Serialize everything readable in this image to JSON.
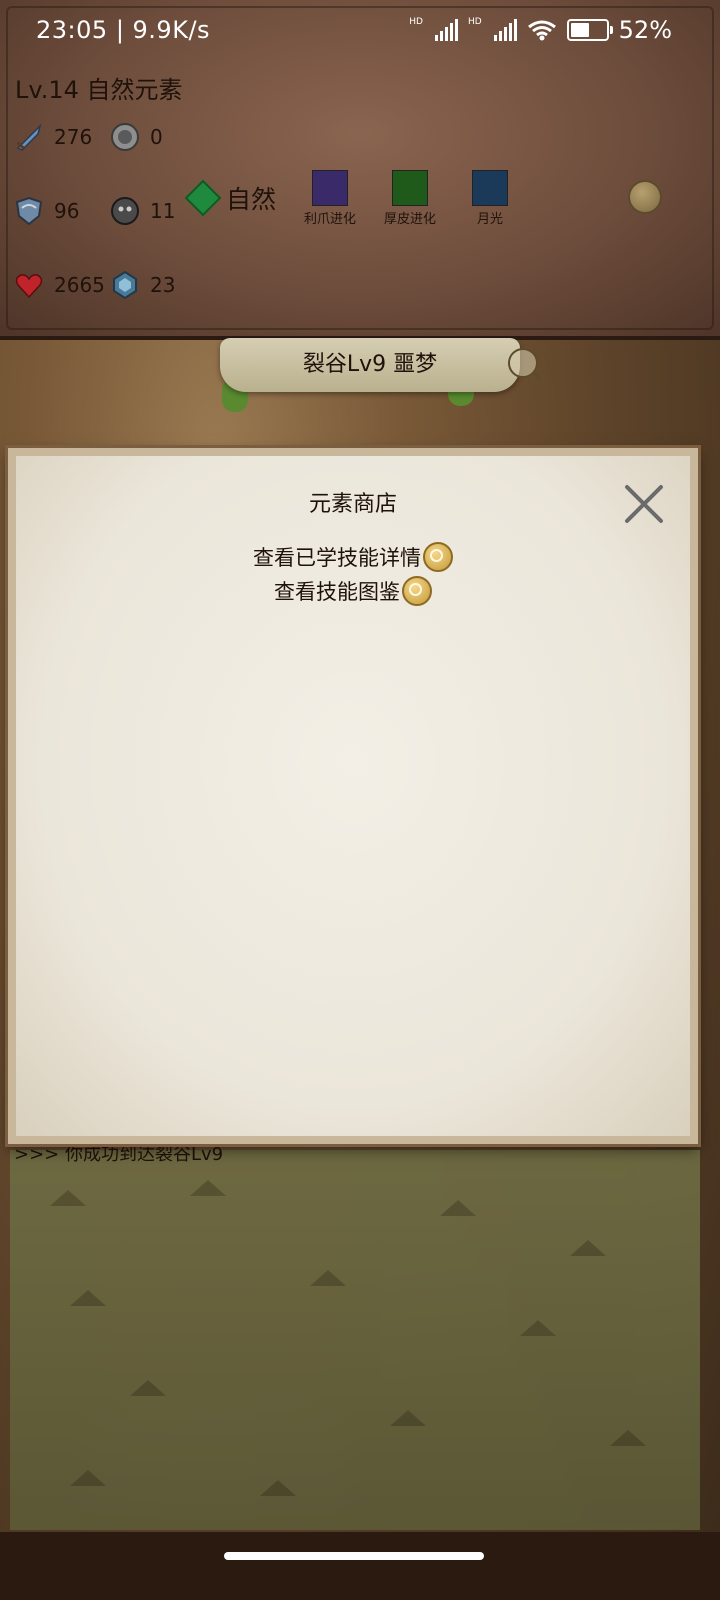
{
  "status_bar": {
    "time": "23:05",
    "speed": "9.9K/s",
    "hd1": "HD",
    "hd2": "HD",
    "battery": "52%",
    "battery_level": 0.52
  },
  "player": {
    "title": "Lv.14 自然元素",
    "stats": {
      "attack": "276",
      "coin": "0",
      "defense": "96",
      "skull": "11",
      "hp": "2665",
      "crystal": "23"
    },
    "element": "自然",
    "skills": [
      {
        "label": "利爪进化",
        "icon": "claw-skill-icon",
        "color": "#3a2a6a"
      },
      {
        "label": "厚皮进化",
        "icon": "thick-skin-skill-icon",
        "color": "#1f5a1a"
      },
      {
        "label": "月光",
        "icon": "moonlight-skill-icon",
        "color": "#1b3a5a"
      }
    ]
  },
  "area": {
    "banner": "裂谷Lv9 噩梦"
  },
  "log": {
    "line": ">>> 你成功到达裂谷Lv9"
  },
  "dialog": {
    "title": "元素商店",
    "links": [
      "查看已学技能详情",
      "查看技能图鉴"
    ]
  }
}
